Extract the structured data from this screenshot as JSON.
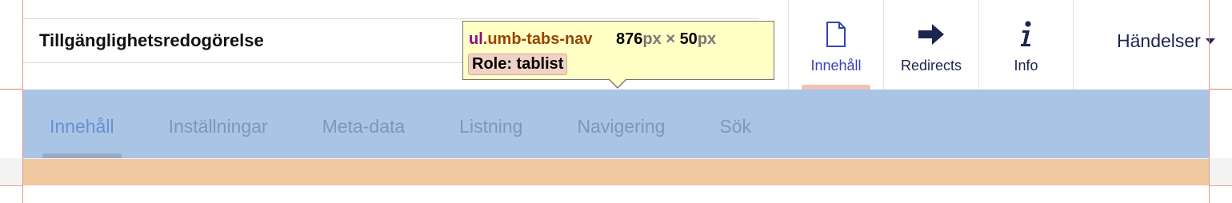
{
  "editor": {
    "name_value": "Tillgänglighetsredogörelse"
  },
  "app_tabs": [
    {
      "label": "Innehåll",
      "icon": "document-icon",
      "active": true
    },
    {
      "label": "Redirects",
      "icon": "arrow-right-icon",
      "active": false
    },
    {
      "label": "Info",
      "icon": "info-icon",
      "active": false
    }
  ],
  "actions": {
    "label": "Händelser"
  },
  "content_tabs": [
    {
      "label": "Innehåll",
      "active": true
    },
    {
      "label": "Inställningar"
    },
    {
      "label": "Meta-data"
    },
    {
      "label": "Listning"
    },
    {
      "label": "Navigering"
    },
    {
      "label": "Sök"
    }
  ],
  "inspector_tooltip": {
    "tag": "ul",
    "class": ".umb-tabs-nav",
    "width": "876",
    "height": "50",
    "unit": "px",
    "times": "×",
    "role": "Role: tablist"
  },
  "colors": {
    "tabs_nav_overlay": "#a9c4e5",
    "margin_overlay": "#f1c9a1",
    "tooltip_bg": "#ffffc6",
    "active_tab_text": "#3544b1",
    "nav_text": "#1b264f"
  }
}
